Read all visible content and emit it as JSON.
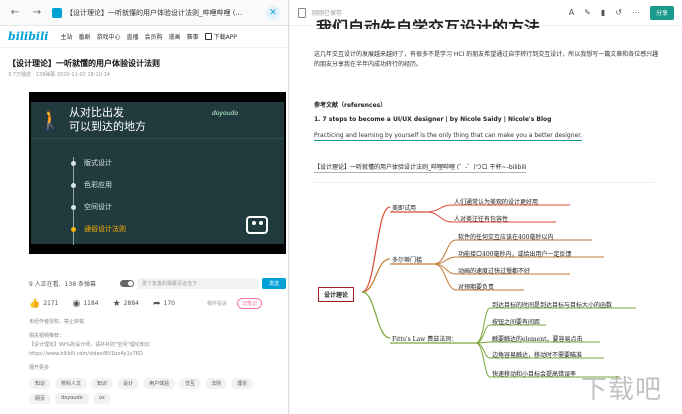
{
  "browser": {
    "tab_title": "【设计理论】一听就懂的用户体验设计法则_哔哩哔哩 (...",
    "back": "←",
    "forward": "→",
    "close": "✕"
  },
  "bili": {
    "logo": "bilibili",
    "nav": [
      "主站",
      "番剧",
      "游戏中心",
      "直播",
      "会员购",
      "漫画",
      "赛事"
    ],
    "app_label": "下载APP",
    "video_title": "【设计理论】一听就懂的用户体验设计法则",
    "video_meta": "3.7万播放 · 139弹幕   2020-11-02 18:10:14",
    "screen": {
      "brand": "doyoudo",
      "headline_1": "从对比出发",
      "headline_2": "可以到达的地方",
      "toc": [
        "版式设计",
        "色彩应用",
        "空间设计",
        "通俗设计法则"
      ]
    },
    "danmaku": {
      "online": "9 人正在看,",
      "count": "138 条弹幕",
      "placeholder": "发个友善的弹幕见证当下",
      "etiquette": "弹幕礼仪 >",
      "send": "发送"
    },
    "actions": {
      "like": "2171",
      "coin": "1184",
      "fav": "2884",
      "share": "170",
      "report": "稿件投诉",
      "notice": "记笔记"
    },
    "desc": {
      "warn": "未经作者授权，禁止转载",
      "related": "相关视频推荐：",
      "line1": "【设计理论】99%的设计师，请补补的\"空间\"理论知识",
      "line2": "https://www.bilibili.com/video/BV1bx4y1y7KD",
      "more": "展开更多"
    },
    "tags": [
      "知识",
      "校科人文",
      "知识",
      "设计",
      "用户体验",
      "交互",
      "法则",
      "理论",
      "网页",
      "doyoudo",
      "ux"
    ]
  },
  "notes": {
    "saved": "刚刚已保存",
    "share": "分享",
    "title_partial": "我们自动先自学交互设计的方法",
    "para": "这几年交互设计的发展越来越好了，有很多不是学习 HCI 的朋友希望通过自学转行到交互设计，所以我想写一篇文章和各位感兴趣的朋友分享我在半年内成功转行的经历。",
    "ref_heading": "参考文献（references）",
    "ref_1": "1. 7 steps to become a UI/UX designer | by Nicole Saidy | Nicole's Blog",
    "ref_2": "Practicing and learning by yourself is the only thing that can make you a better designer.",
    "video_link": "【设计理论】一听就懂的用户体验设计法则_哔哩哔哩 (゜-゜)つロ 干杯~-bilibili"
  },
  "mindmap": {
    "root": "设计理论",
    "branches": [
      {
        "label": "美即试用",
        "children": [
          "人们通常认为美观的设计更好用",
          "人对美注往有包容性"
        ]
      },
      {
        "label": "多尔蒂门槛",
        "children": [
          "软件的任何交互应该在400毫秒以内",
          "功能接口400毫秒内，或给出用户一定反馈",
          "动画的速度过快过慢都不好",
          "对预期要负责"
        ]
      },
      {
        "label": "Fitts's Law 费兹法则：",
        "children": [
          "到达目标的时间是到达目标与目标大小的函数",
          "按钮之间要有间距",
          "触要触达的element，要容易点击",
          "边角容易触达，移动时不需要瞄准",
          "快速移动和小目标会提高错误率"
        ]
      }
    ]
  },
  "colors": {
    "bili_blue": "#00a1d6",
    "player_bg": "#203a3e",
    "toc_active": "#ffb400",
    "branch_1": "#d94a3a",
    "branch_2": "#c07a30",
    "branch_3": "#7aa83a",
    "share_btn": "#1a9a8a"
  },
  "watermark": "下载吧"
}
